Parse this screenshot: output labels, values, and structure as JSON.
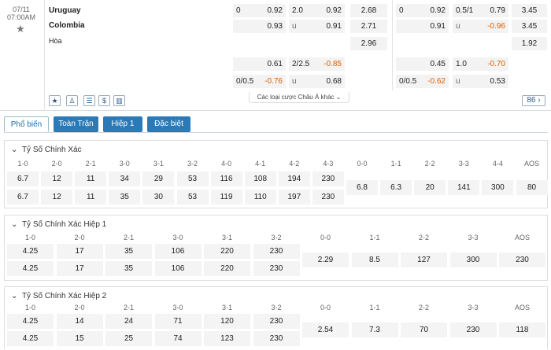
{
  "match": {
    "date": "07/11",
    "time": "07:00AM",
    "home": "Uruguay",
    "away": "Colombia",
    "draw": "Hòa",
    "odds_count": "86",
    "more_bets_label": "Các loại cược Châu Á khác"
  },
  "odds": {
    "ft_hdp": {
      "row1": {
        "line": "0",
        "val": "0.92"
      },
      "row2": {
        "val": "0.93"
      }
    },
    "ft_ou": {
      "row1": {
        "line": "2.0",
        "val": "0.92"
      },
      "row2": {
        "line": "u",
        "val": "0.91"
      }
    },
    "ft_1x2": [
      "2.68",
      "2.71",
      "2.96"
    ],
    "h1_hdp": {
      "row1": {
        "line": "",
        "val": "0.61"
      },
      "row2": {
        "line": "0/0.5",
        "val": "-0.76"
      }
    },
    "h1_ou": {
      "row1": {
        "line": "2/2.5",
        "val": "-0.85"
      },
      "row2": {
        "line": "u",
        "val": "0.68"
      }
    },
    "r_ft_hdp": {
      "row1": {
        "line": "0",
        "val": "0.92"
      },
      "row2": {
        "val": "0.91"
      }
    },
    "r_ft_ou": {
      "row1": {
        "line": "0.5/1",
        "val": "0.79"
      },
      "row2": {
        "line": "u",
        "val": "-0.96"
      }
    },
    "r_ft_1x2": [
      "3.45",
      "3.45",
      "1.92"
    ],
    "r_h1_hdp": {
      "row1": {
        "line": "",
        "val": "0.45"
      },
      "row2": {
        "line": "0/0.5",
        "val": "-0.62"
      }
    },
    "r_h1_ou": {
      "row1": {
        "line": "1.0",
        "val": "-0.70"
      },
      "row2": {
        "line": "u",
        "val": "0.53"
      }
    }
  },
  "tabs": [
    "Phổ biến",
    "Toàn Trận",
    "Hiệp 1",
    "Đặc biệt"
  ],
  "sections": [
    {
      "title": "Tỷ Số Chính Xác",
      "headers": [
        "1-0",
        "2-0",
        "2-1",
        "3-0",
        "3-1",
        "3-2",
        "4-0",
        "4-1",
        "4-2",
        "4-3",
        "0-0",
        "1-1",
        "2-2",
        "3-3",
        "4-4",
        "AOS"
      ],
      "home_row": [
        "6.7",
        "12",
        "11",
        "34",
        "29",
        "53",
        "116",
        "108",
        "194",
        "230"
      ],
      "away_row": [
        "6.7",
        "12",
        "11",
        "35",
        "30",
        "53",
        "119",
        "110",
        "197",
        "230"
      ],
      "draw_row": [
        "6.8",
        "6.3",
        "20",
        "141",
        "300",
        "80"
      ]
    },
    {
      "title": "Tỷ Số Chính Xác Hiệp 1",
      "headers": [
        "1-0",
        "2-0",
        "2-1",
        "3-0",
        "3-1",
        "3-2",
        "0-0",
        "1-1",
        "2-2",
        "3-3",
        "AOS"
      ],
      "home_row": [
        "4.25",
        "17",
        "35",
        "106",
        "220",
        "230"
      ],
      "away_row": [
        "4.25",
        "17",
        "35",
        "106",
        "220",
        "230"
      ],
      "draw_row": [
        "2.29",
        "8.5",
        "127",
        "300",
        "230"
      ]
    },
    {
      "title": "Tỷ Số Chính Xác Hiệp 2",
      "headers": [
        "1-0",
        "2-0",
        "2-1",
        "3-0",
        "3-1",
        "3-2",
        "0-0",
        "1-1",
        "2-2",
        "3-3",
        "AOS"
      ],
      "home_row": [
        "4.25",
        "14",
        "24",
        "71",
        "120",
        "230"
      ],
      "away_row": [
        "4.25",
        "15",
        "25",
        "74",
        "123",
        "230"
      ],
      "draw_row": [
        "2.54",
        "7.3",
        "70",
        "230",
        "118"
      ]
    }
  ],
  "colors": {
    "accent": "#2a7ab8",
    "negative": "#e06000"
  }
}
